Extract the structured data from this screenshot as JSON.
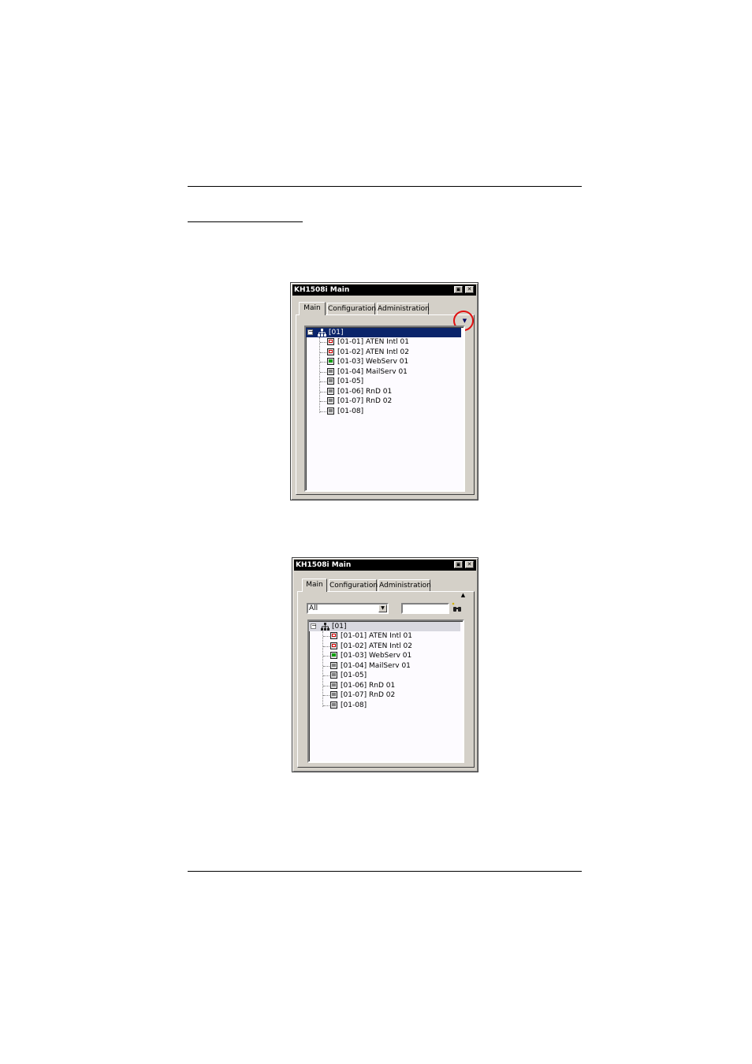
{
  "window1": {
    "title": "KH1508i Main",
    "tabs": [
      "Main",
      "Configuration",
      "Administration"
    ],
    "root": "[01]",
    "items": [
      {
        "label": "[01-01] ATEN Intl 01",
        "status": "red"
      },
      {
        "label": "[01-02] ATEN Intl 02",
        "status": "red"
      },
      {
        "label": "[01-03] WebServ 01",
        "status": "green"
      },
      {
        "label": "[01-04] MailServ 01",
        "status": "gray"
      },
      {
        "label": "[01-05]",
        "status": "gray"
      },
      {
        "label": "[01-06] RnD 01",
        "status": "gray"
      },
      {
        "label": "[01-07] RnD 02",
        "status": "gray"
      },
      {
        "label": "[01-08]",
        "status": "gray"
      }
    ]
  },
  "window2": {
    "title": "KH1508i Main",
    "tabs": [
      "Main",
      "Configuration",
      "Administration"
    ],
    "filter_value": "All",
    "search_value": "",
    "root": "[01]",
    "items": [
      {
        "label": "[01-01] ATEN Intl 01",
        "status": "red"
      },
      {
        "label": "[01-02] ATEN Intl 02",
        "status": "red"
      },
      {
        "label": "[01-03] WebServ 01",
        "status": "green"
      },
      {
        "label": "[01-04] MailServ 01",
        "status": "gray"
      },
      {
        "label": "[01-05]",
        "status": "gray"
      },
      {
        "label": "[01-06] RnD 01",
        "status": "gray"
      },
      {
        "label": "[01-07] RnD 02",
        "status": "gray"
      },
      {
        "label": "[01-08]",
        "status": "gray"
      }
    ]
  },
  "colors": {
    "highlight": "#0a246a",
    "callout": "#e01010",
    "window_face": "#d4d0c8"
  }
}
